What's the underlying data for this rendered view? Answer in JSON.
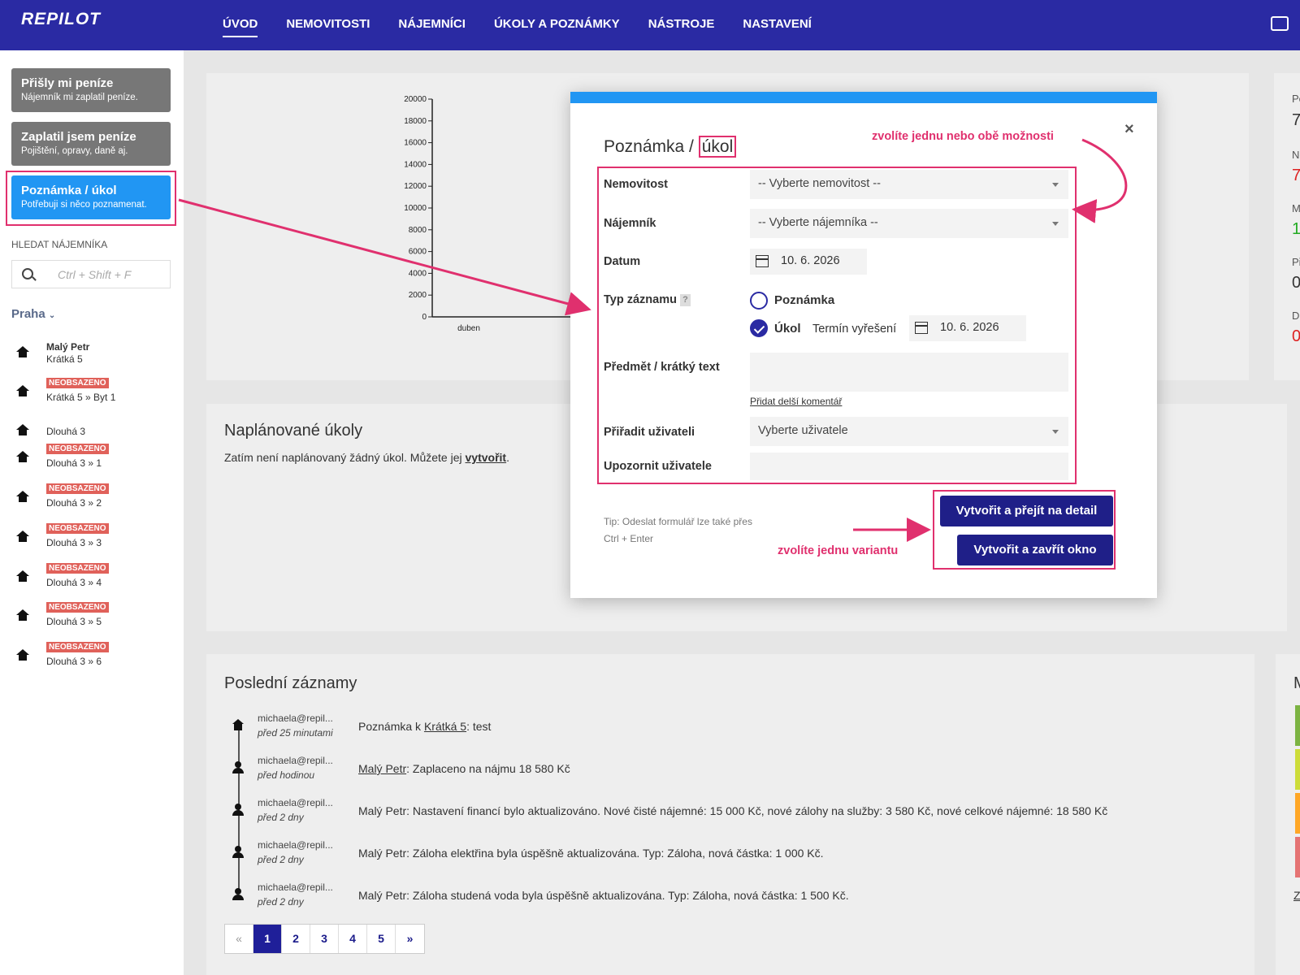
{
  "app": {
    "logo": "REPILOT"
  },
  "nav": {
    "items": [
      "ÚVOD",
      "NEMOVITOSTI",
      "NÁJEMNÍCI",
      "ÚKOLY A POZNÁMKY",
      "NÁSTROJE",
      "NASTAVENÍ"
    ],
    "active": "ÚVOD"
  },
  "sidebar": {
    "buttons": [
      {
        "title": "Přišly mi peníze",
        "subtitle": "Nájemník mi zaplatil peníze."
      },
      {
        "title": "Zaplatil jsem peníze",
        "subtitle": "Pojištění, opravy, daně aj."
      },
      {
        "title": "Poznámka / úkol",
        "subtitle": "Potřebuji si něco poznamenat."
      }
    ],
    "search_label": "HLEDAT NÁJEMNÍKA",
    "search_placeholder": "Ctrl + Shift + F",
    "city": "Praha",
    "properties": [
      {
        "name": "Malý Petr",
        "sub": "Krátká 5",
        "badge": ""
      },
      {
        "name": "Krátká 5 » Byt 1",
        "sub": "",
        "badge": "NEOBSAZENO"
      },
      {
        "name": "Dlouhá 3",
        "sub": "",
        "badge": ""
      },
      {
        "name": "Dlouhá 3 » 1",
        "sub": "",
        "badge": "NEOBSAZENO"
      },
      {
        "name": "Dlouhá 3 » 2",
        "sub": "",
        "badge": "NEOBSAZENO"
      },
      {
        "name": "Dlouhá 3 » 3",
        "sub": "",
        "badge": "NEOBSAZENO"
      },
      {
        "name": "Dlouhá 3 » 4",
        "sub": "",
        "badge": "NEOBSAZENO"
      },
      {
        "name": "Dlouhá 3 » 5",
        "sub": "",
        "badge": "NEOBSAZENO"
      },
      {
        "name": "Dlouhá 3 » 6",
        "sub": "",
        "badge": "NEOBSAZENO"
      }
    ]
  },
  "chart_data": {
    "type": "bar",
    "categories": [
      "duben"
    ],
    "values": [
      0
    ],
    "ylim": [
      0,
      20000
    ],
    "yticks": [
      0,
      2000,
      4000,
      6000,
      8000,
      10000,
      12000,
      14000,
      16000,
      18000,
      20000
    ],
    "title": "",
    "xlabel": "",
    "ylabel": ""
  },
  "right_panel": {
    "labels": [
      "Po",
      "Ne",
      "M",
      "Př",
      "Dl"
    ],
    "values": [
      "7",
      "7",
      "1",
      "0",
      "0"
    ]
  },
  "tasks": {
    "title": "Naplánované úkoly",
    "text": "Zatím není naplánovaný žádný úkol. Můžete jej ",
    "link": "vytvořit",
    "after": "."
  },
  "records": {
    "title": "Poslední záznamy",
    "items": [
      {
        "user": "michaela@repil...",
        "time": "před 25 minutami",
        "icon": "house-icon",
        "prefix": "Poznámka k ",
        "link": "Krátká 5",
        "rest": ": test"
      },
      {
        "user": "michaela@repil...",
        "time": "před hodinou",
        "icon": "person-icon",
        "prefix": "",
        "link": "Malý Petr",
        "rest": ": Zaplaceno na nájmu 18 580 Kč"
      },
      {
        "user": "michaela@repil...",
        "time": "před 2 dny",
        "icon": "person-icon",
        "prefix": "",
        "link": "",
        "rest": "Malý Petr: Nastavení financí bylo aktualizováno. Nové čisté nájemné: 15 000 Kč, nové zálohy na služby: 3 580 Kč, nové celkové nájemné: 18 580 Kč"
      },
      {
        "user": "michaela@repil...",
        "time": "před 2 dny",
        "icon": "person-icon",
        "prefix": "",
        "link": "",
        "rest": "Malý Petr: Záloha elektřina byla úspěšně aktualizována. Typ: Záloha, nová částka: 1 000 Kč."
      },
      {
        "user": "michaela@repil...",
        "time": "před 2 dny",
        "icon": "person-icon",
        "prefix": "",
        "link": "",
        "rest": "Malý Petr: Záloha studená voda byla úspěšně aktualizována. Typ: Záloha, nová částka: 1 500 Kč."
      }
    ],
    "pages": [
      "«",
      "1",
      "2",
      "3",
      "4",
      "5",
      "»"
    ],
    "active_page": "1"
  },
  "right_panel2": {
    "label": "M",
    "link": "Z"
  },
  "modal": {
    "title_prefix": "Poznámka / ",
    "title_boxed": "úkol",
    "close": "×",
    "fields": {
      "property_label": "Nemovitost",
      "property_value": "-- Vyberte nemovitost --",
      "tenant_label": "Nájemník",
      "tenant_value": "-- Vyberte nájemníka --",
      "date_label": "Datum",
      "date_value": "10. 6. 2026",
      "type_label": "Typ záznamu",
      "type_help": "?",
      "option_note": "Poznámka",
      "option_task": "Úkol",
      "deadline_label": "Termín vyřešení",
      "deadline_value": "10. 6. 2026",
      "subject_label": "Předmět / krátký text",
      "subject_value": "",
      "comment_link": "Přidat delší komentář",
      "assign_label": "Přiřadit uživateli",
      "assign_value": "Vyberte uživatele",
      "notify_label": "Upozornit uživatele",
      "notify_value": ""
    },
    "tip": "Tip: Odeslat formulář lze také přes Ctrl + Enter",
    "btn_detail": "Vytvořit a přejít na detail",
    "btn_close": "Vytvořit a zavřít okno"
  },
  "annotations": {
    "choose_options": "zvolíte jednu nebo obě možnosti",
    "choose_variant": "zvolíte jednu variantu"
  },
  "colors": {
    "primary": "#2a2aa3",
    "accent": "#2196f3",
    "highlight": "#e0306e",
    "badge": "#e0615a"
  }
}
